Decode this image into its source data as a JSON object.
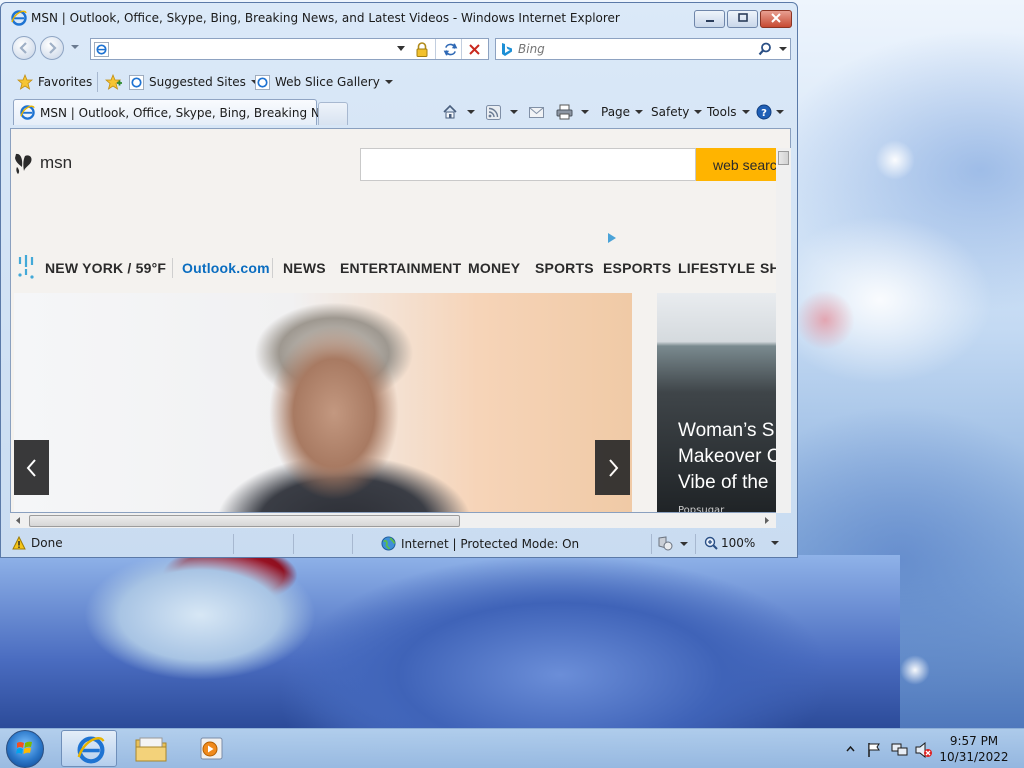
{
  "window": {
    "title": "MSN | Outlook, Office, Skype, Bing, Breaking News, and Latest Videos - Windows Internet Explorer"
  },
  "address_bar": {
    "value": "",
    "placeholder": ""
  },
  "search_bar": {
    "placeholder": "Bing"
  },
  "favorites_bar": {
    "favorites": "Favorites",
    "suggested_sites": "Suggested Sites",
    "web_slice_gallery": "Web Slice Gallery"
  },
  "tab": {
    "label": "MSN | Outlook, Office, Skype, Bing, Breaking Ne..."
  },
  "command_bar": {
    "page": "Page",
    "safety": "Safety",
    "tools": "Tools"
  },
  "page": {
    "logo_text": "msn",
    "search_button": "web search",
    "nav": {
      "weather": "NEW YORK / 59°F",
      "outlook": "Outlook.com",
      "items": [
        "NEWS",
        "ENTERTAINMENT",
        "MONEY",
        "SPORTS",
        "ESPORTS",
        "LIFESTYLE",
        "SH"
      ]
    },
    "side_card": {
      "title": "Woman’s S\nMakeover C\nVibe of the",
      "source": "Popsugar"
    }
  },
  "status_bar": {
    "status": "Done",
    "zone": "Internet | Protected Mode: On",
    "zoom": "100%"
  },
  "taskbar": {
    "clock_time": "9:57 PM",
    "clock_date": "10/31/2022"
  },
  "colors": {
    "accent": "#0a6dc0",
    "search_button": "#ffb400",
    "close_button": "#c74a32"
  }
}
